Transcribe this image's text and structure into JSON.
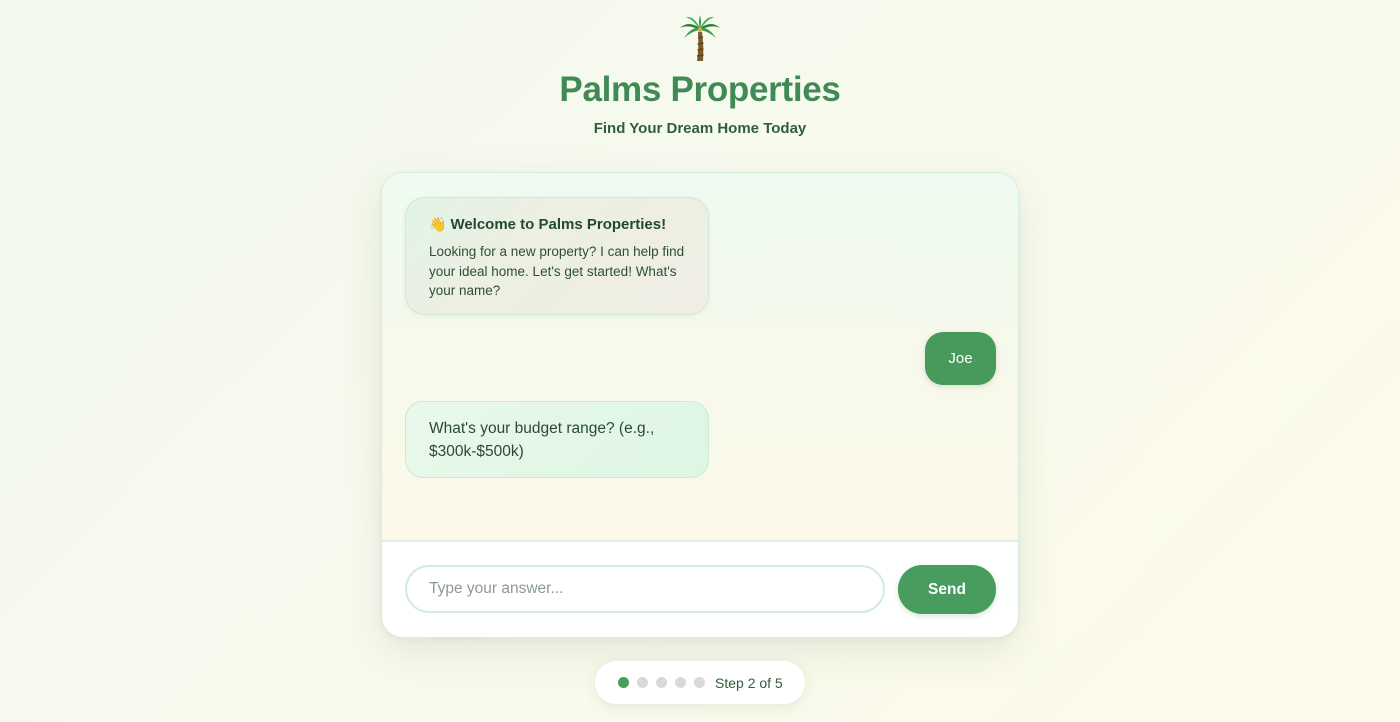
{
  "header": {
    "logo_icon": "palm-tree-icon",
    "title": "Palms Properties",
    "subtitle": "Find Your Dream Home Today"
  },
  "chat": {
    "messages": [
      {
        "role": "bot",
        "icon": "waving-hand-icon",
        "title": "Welcome to Palms Properties!",
        "text": "Looking for a new property? I can help find your ideal home. Let's get started! What's your name?"
      },
      {
        "role": "user",
        "text": "Joe"
      },
      {
        "role": "bot",
        "text": "What's your budget range? (e.g., $300k-$500k)"
      }
    ],
    "input": {
      "placeholder": "Type your answer...",
      "value": ""
    },
    "send_label": "Send"
  },
  "progress": {
    "current_step": 2,
    "total_steps": 5,
    "label": "Step 2 of 5"
  },
  "colors": {
    "brand_green": "#3f8a55",
    "button_green": "#489c5d",
    "inactive_dot": "#d9d9d9"
  }
}
